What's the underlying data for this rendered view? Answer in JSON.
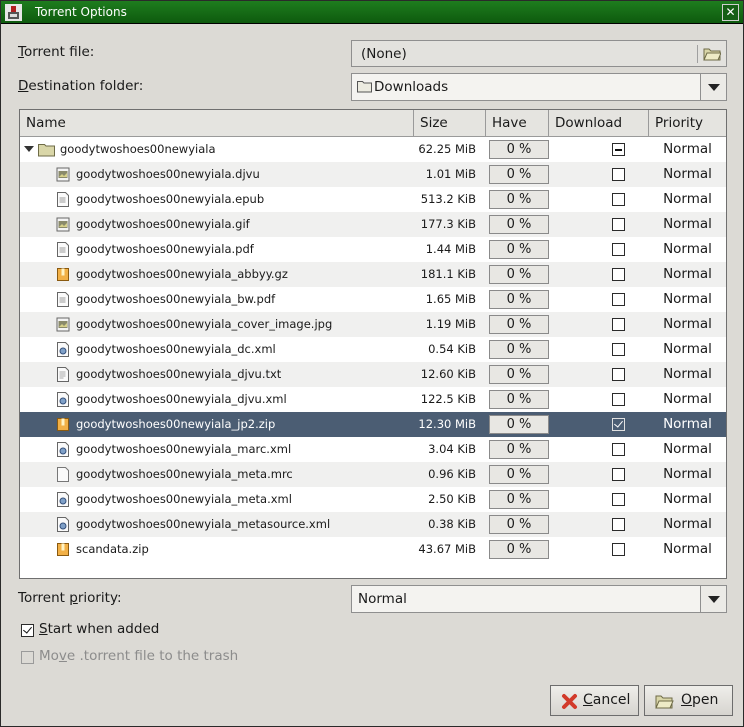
{
  "window": {
    "title": "Torrent Options",
    "close_label": "✕"
  },
  "torrent_file": {
    "label_prefix": "",
    "label_mnemonic": "T",
    "label_rest": "orrent file:",
    "value": "(None)"
  },
  "destination": {
    "label_mnemonic": "D",
    "label_rest": "estination folder:",
    "value": "Downloads"
  },
  "columns": [
    "Name",
    "Size",
    "Have",
    "Download",
    "Priority"
  ],
  "folder": {
    "name": "goodytwoshoes00newyiala",
    "size": "62.25 MiB",
    "have": "0 %",
    "download": "mixed",
    "priority": "Normal"
  },
  "files": [
    {
      "name": "goodytwoshoes00newyiala.djvu",
      "size": "1.01 MiB",
      "have": "0 %",
      "icon": "image-icon",
      "checked": false,
      "priority": "Normal"
    },
    {
      "name": "goodytwoshoes00newyiala.epub",
      "size": "513.2 KiB",
      "have": "0 %",
      "icon": "document-icon",
      "checked": false,
      "priority": "Normal"
    },
    {
      "name": "goodytwoshoes00newyiala.gif",
      "size": "177.3 KiB",
      "have": "0 %",
      "icon": "image-icon",
      "checked": false,
      "priority": "Normal"
    },
    {
      "name": "goodytwoshoes00newyiala.pdf",
      "size": "1.44 MiB",
      "have": "0 %",
      "icon": "document-icon",
      "checked": false,
      "priority": "Normal"
    },
    {
      "name": "goodytwoshoes00newyiala_abbyy.gz",
      "size": "181.1 KiB",
      "have": "0 %",
      "icon": "archive-icon",
      "checked": false,
      "priority": "Normal"
    },
    {
      "name": "goodytwoshoes00newyiala_bw.pdf",
      "size": "1.65 MiB",
      "have": "0 %",
      "icon": "document-icon",
      "checked": false,
      "priority": "Normal"
    },
    {
      "name": "goodytwoshoes00newyiala_cover_image.jpg",
      "size": "1.19 MiB",
      "have": "0 %",
      "icon": "image-icon",
      "checked": false,
      "priority": "Normal"
    },
    {
      "name": "goodytwoshoes00newyiala_dc.xml",
      "size": "0.54 KiB",
      "have": "0 %",
      "icon": "xml-icon",
      "checked": false,
      "priority": "Normal"
    },
    {
      "name": "goodytwoshoes00newyiala_djvu.txt",
      "size": "12.60 KiB",
      "have": "0 %",
      "icon": "text-icon",
      "checked": false,
      "priority": "Normal"
    },
    {
      "name": "goodytwoshoes00newyiala_djvu.xml",
      "size": "122.5 KiB",
      "have": "0 %",
      "icon": "xml-icon",
      "checked": false,
      "priority": "Normal"
    },
    {
      "name": "goodytwoshoes00newyiala_jp2.zip",
      "size": "12.30 MiB",
      "have": "0 %",
      "icon": "archive-icon",
      "checked": true,
      "selected": true,
      "priority": "Normal"
    },
    {
      "name": "goodytwoshoes00newyiala_marc.xml",
      "size": "3.04 KiB",
      "have": "0 %",
      "icon": "xml-icon",
      "checked": false,
      "priority": "Normal"
    },
    {
      "name": "goodytwoshoes00newyiala_meta.mrc",
      "size": "0.96 KiB",
      "have": "0 %",
      "icon": "blank-file-icon",
      "checked": false,
      "priority": "Normal"
    },
    {
      "name": "goodytwoshoes00newyiala_meta.xml",
      "size": "2.50 KiB",
      "have": "0 %",
      "icon": "xml-icon",
      "checked": false,
      "priority": "Normal"
    },
    {
      "name": "goodytwoshoes00newyiala_metasource.xml",
      "size": "0.38 KiB",
      "have": "0 %",
      "icon": "xml-icon",
      "checked": false,
      "priority": "Normal"
    },
    {
      "name": "scandata.zip",
      "size": "43.67 MiB",
      "have": "0 %",
      "icon": "archive-icon",
      "checked": false,
      "priority": "Normal"
    }
  ],
  "torrent_priority": {
    "label_before": "Torrent ",
    "label_mnemonic": "p",
    "label_after": "riority:",
    "value": "Normal"
  },
  "start_when_added": {
    "label_mnemonic": "S",
    "label_rest": "tart when added",
    "checked": true
  },
  "move_to_trash": {
    "label_before": "Mo",
    "label_mnemonic": "v",
    "label_after": "e .torrent file to the trash",
    "checked": false,
    "enabled": false
  },
  "buttons": {
    "cancel_mnemonic": "C",
    "cancel_rest": "ancel",
    "open_mnemonic": "O",
    "open_rest": "pen"
  },
  "colors": {
    "titlebar": "#1e7d1e",
    "selected_row": "#4b5d73",
    "cancel_icon": "#d23a2a",
    "folder_icon": "#d9d6a8"
  }
}
